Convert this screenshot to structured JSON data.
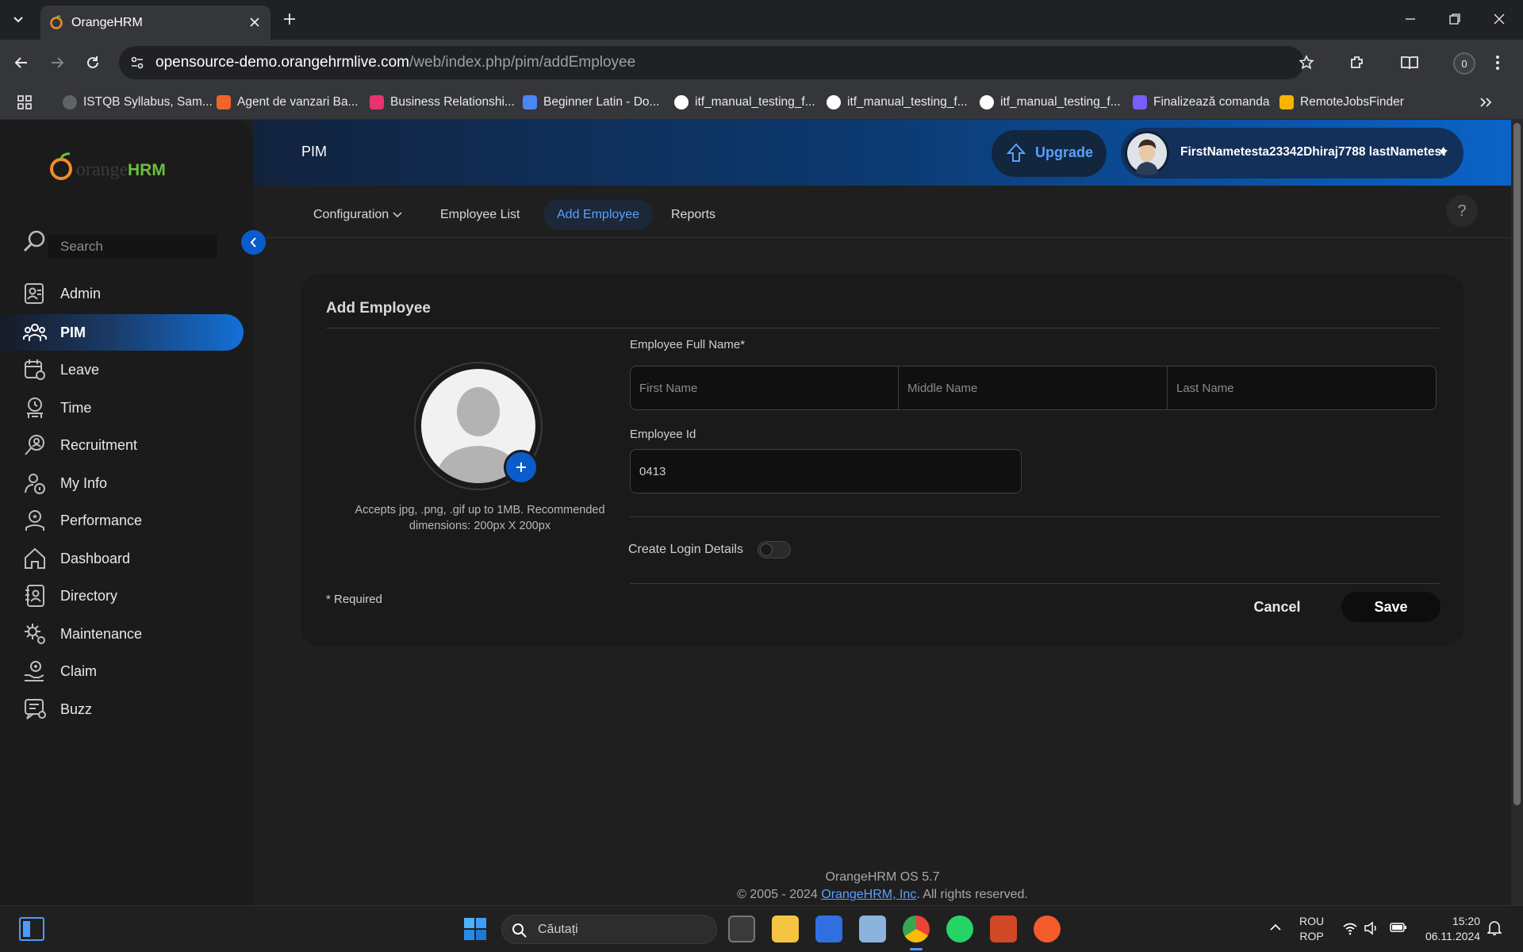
{
  "browser": {
    "tab_title": "OrangeHRM",
    "url_host": "opensource-demo.orangehrmlive.com",
    "url_path": "/web/index.php/pim/addEmployee",
    "profile_initial": "0",
    "bookmarks": [
      {
        "label": "ISTQB Syllabus, Sam...",
        "color": "#5f6368"
      },
      {
        "label": "Agent de vanzari Ba...",
        "color": "#f0642a"
      },
      {
        "label": "Business Relationshi...",
        "color": "#e8336d"
      },
      {
        "label": "Beginner Latin - Do...",
        "color": "#4a86f5"
      },
      {
        "label": "itf_manual_testing_f...",
        "color": "#ffffff"
      },
      {
        "label": "itf_manual_testing_f...",
        "color": "#ffffff"
      },
      {
        "label": "itf_manual_testing_f...",
        "color": "#ffffff"
      },
      {
        "label": "Finalizează comanda",
        "color": "#7a5cff"
      },
      {
        "label": "RemoteJobsFinder",
        "color": "#f5b400"
      }
    ]
  },
  "app": {
    "logo_text_orange": "orange",
    "logo_text_hrm": "HRM",
    "search_placeholder": "Search",
    "page_title": "PIM",
    "upgrade_label": "Upgrade",
    "user_name": "FirstNametesta23342Dhiraj7788 lastNametest",
    "sidebar": [
      {
        "label": "Admin",
        "icon": "admin-icon"
      },
      {
        "label": "PIM",
        "icon": "pim-icon",
        "active": true
      },
      {
        "label": "Leave",
        "icon": "leave-icon"
      },
      {
        "label": "Time",
        "icon": "time-icon"
      },
      {
        "label": "Recruitment",
        "icon": "recruitment-icon"
      },
      {
        "label": "My Info",
        "icon": "my-info-icon"
      },
      {
        "label": "Performance",
        "icon": "performance-icon"
      },
      {
        "label": "Dashboard",
        "icon": "dashboard-icon"
      },
      {
        "label": "Directory",
        "icon": "directory-icon"
      },
      {
        "label": "Maintenance",
        "icon": "maintenance-icon"
      },
      {
        "label": "Claim",
        "icon": "claim-icon"
      },
      {
        "label": "Buzz",
        "icon": "buzz-icon"
      }
    ],
    "topnav": {
      "configuration": "Configuration",
      "employee_list": "Employee List",
      "add_employee": "Add Employee",
      "reports": "Reports",
      "help": "?"
    }
  },
  "form": {
    "title": "Add Employee",
    "full_name_label": "Employee Full Name*",
    "first_name_placeholder": "First Name",
    "middle_name_placeholder": "Middle Name",
    "last_name_placeholder": "Last Name",
    "employee_id_label": "Employee Id",
    "employee_id_value": "0413",
    "photo_hint": "Accepts jpg, .png, .gif up to 1MB. Recommended dimensions: 200px X 200px",
    "create_login_label": "Create Login Details",
    "create_login_enabled": false,
    "required_note": "* Required",
    "cancel_label": "Cancel",
    "save_label": "Save"
  },
  "footer": {
    "version": "OrangeHRM OS 5.7",
    "copyright_prefix": "© 2005 - 2024 ",
    "company_link": "OrangeHRM, Inc",
    "copyright_suffix": ". All rights reserved."
  },
  "taskbar": {
    "search_placeholder": "Căutați",
    "lang_top": "ROU",
    "lang_bottom": "ROP",
    "time": "15:20",
    "date": "06.11.2024"
  },
  "colors": {
    "accent_blue": "#0a64c8",
    "brand_orange": "#f28c28",
    "active_tab_text": "#5aa0ff"
  }
}
